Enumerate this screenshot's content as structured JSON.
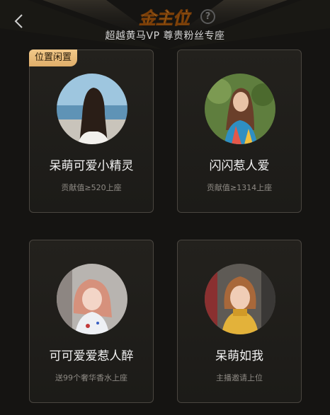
{
  "header": {
    "title": "金主位",
    "help_label": "?",
    "subtitle": "超越黄马VP 尊贵粉丝专座",
    "accent_color": "#f2c98a"
  },
  "seats": [
    {
      "badge": "位置闲置",
      "name": "呆萌可爱小精灵",
      "requirement": "贡献值≥520上座",
      "avatar": "avatar-girl-long-hair-sea"
    },
    {
      "badge": "",
      "name": "闪闪惹人爱",
      "requirement": "贡献值≥1314上座",
      "avatar": "avatar-girl-colorful-dress"
    },
    {
      "badge": "",
      "name": "可可爱爱惹人醉",
      "requirement": "送99个奢华香水上座",
      "avatar": "avatar-girl-pink-hair"
    },
    {
      "badge": "",
      "name": "呆萌如我",
      "requirement": "主播邀请上位",
      "avatar": "avatar-girl-yellow-sweater"
    }
  ]
}
